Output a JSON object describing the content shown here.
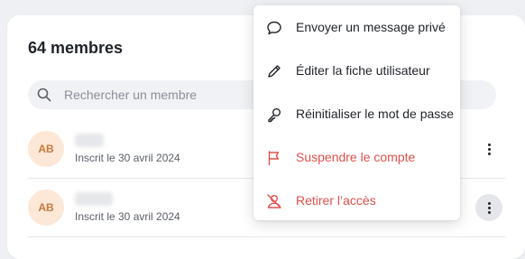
{
  "members": {
    "title": "64 membres",
    "search": {
      "placeholder": "Rechercher un membre"
    },
    "rows": [
      {
        "initials": "AB",
        "meta": "Inscrit le 30 avril 2024"
      },
      {
        "initials": "AB",
        "meta": "Inscrit le 30 avril 2024"
      }
    ]
  },
  "menu": {
    "items": [
      {
        "label": "Envoyer un message privé",
        "icon": "chat-bubble-icon",
        "color": "#1f2329"
      },
      {
        "label": "Éditer la fiche utilisateur",
        "icon": "pencil-icon",
        "color": "#1f2329"
      },
      {
        "label": "Réinitialiser le mot de passe",
        "icon": "key-icon",
        "color": "#1f2329"
      },
      {
        "label": "Suspendre le compte",
        "icon": "flag-icon",
        "color": "#e0504b"
      },
      {
        "label": "Retirer l’accès",
        "icon": "user-remove-icon",
        "color": "#e0504b"
      }
    ]
  },
  "colors": {
    "avatar_bg": "#fde7d6",
    "avatar_text": "#c8793d",
    "danger": "#e0504b"
  }
}
